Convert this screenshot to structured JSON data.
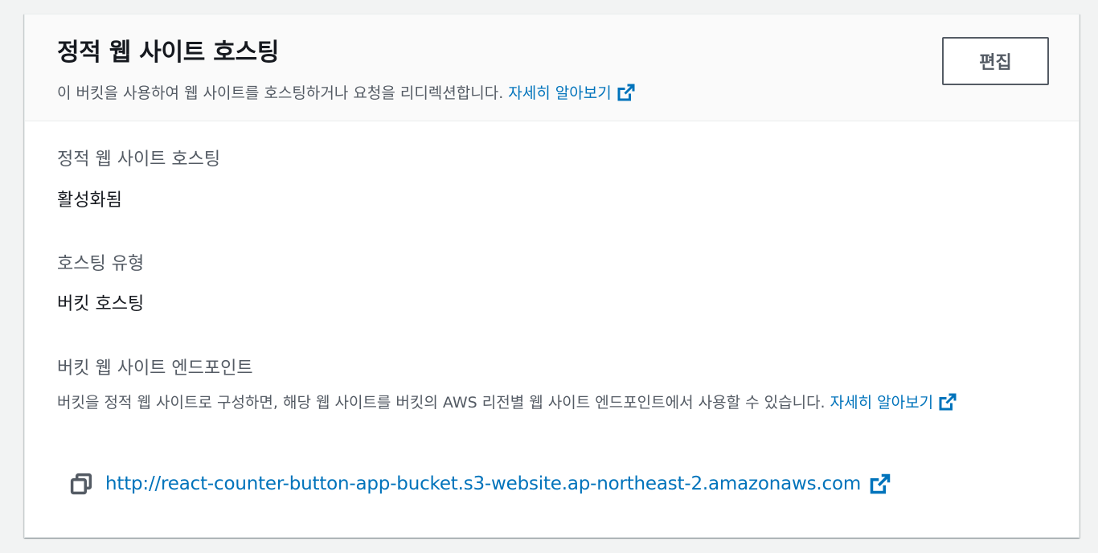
{
  "header": {
    "title": "정적 웹 사이트 호스팅",
    "description": "이 버킷을 사용하여 웹 사이트를 호스팅하거나 요청을 리디렉션합니다.",
    "learn_more": "자세히 알아보기",
    "edit_label": "편집"
  },
  "fields": {
    "hosting": {
      "label": "정적 웹 사이트 호스팅",
      "value": "활성화됨"
    },
    "hosting_type": {
      "label": "호스팅 유형",
      "value": "버킷 호스팅"
    },
    "endpoint": {
      "label": "버킷 웹 사이트 엔드포인트",
      "description": "버킷을 정적 웹 사이트로 구성하면, 해당 웹 사이트를 버킷의 AWS 리전별 웹 사이트 엔드포인트에서 사용할 수 있습니다.",
      "learn_more": "자세히 알아보기",
      "url": "http://react-counter-button-app-bucket.s3-website.ap-northeast-2.amazonaws.com"
    }
  },
  "icons": {
    "external_link": "external-link-icon",
    "copy": "copy-icon"
  },
  "colors": {
    "link": "#0073bb",
    "text_primary": "#16191f",
    "text_secondary": "#545b64",
    "header_bg": "#fafafa",
    "page_bg": "#f2f3f3"
  }
}
